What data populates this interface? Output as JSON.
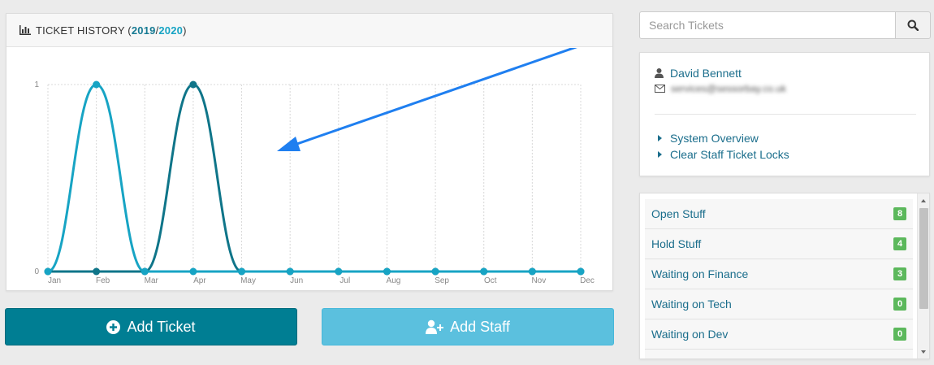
{
  "chart_panel": {
    "title_prefix": "TICKET HISTORY (",
    "year1": "2019",
    "separator": " / ",
    "year2": "2020",
    "title_suffix": ")"
  },
  "chart_data": {
    "type": "line",
    "categories": [
      "Jan",
      "Feb",
      "Mar",
      "Apr",
      "May",
      "Jun",
      "Jul",
      "Aug",
      "Sep",
      "Oct",
      "Nov",
      "Dec"
    ],
    "yticks": [
      "1",
      "0"
    ],
    "ylim": [
      0,
      1
    ],
    "grid": true,
    "series": [
      {
        "values": [
          0,
          1,
          0,
          0,
          0,
          0,
          0,
          0,
          0,
          0,
          0,
          0
        ],
        "color": "#17a4c4"
      },
      {
        "values": [
          0,
          0,
          0,
          1,
          0,
          0,
          0,
          0,
          0,
          0,
          0,
          0
        ],
        "color": "#0f7589"
      }
    ]
  },
  "buttons": {
    "add_ticket": "Add Ticket",
    "add_staff": "Add Staff"
  },
  "search": {
    "placeholder": "Search Tickets"
  },
  "user": {
    "name": "David Bennett",
    "email": "services@sessorbay.co.uk"
  },
  "links": [
    "System Overview",
    "Clear Staff Ticket Locks"
  ],
  "statuses": [
    {
      "label": "Open Stuff",
      "count": "8"
    },
    {
      "label": "Hold Stuff",
      "count": "4"
    },
    {
      "label": "Waiting on Finance",
      "count": "3"
    },
    {
      "label": "Waiting on Tech",
      "count": "0"
    },
    {
      "label": "Waiting on Dev",
      "count": "0"
    }
  ],
  "colors": {
    "accent": "#007e93",
    "secondary": "#5bc0de",
    "badge": "#5cb85c",
    "link": "#1b6e8c",
    "annotation_arrow": "#1f7ff0"
  }
}
